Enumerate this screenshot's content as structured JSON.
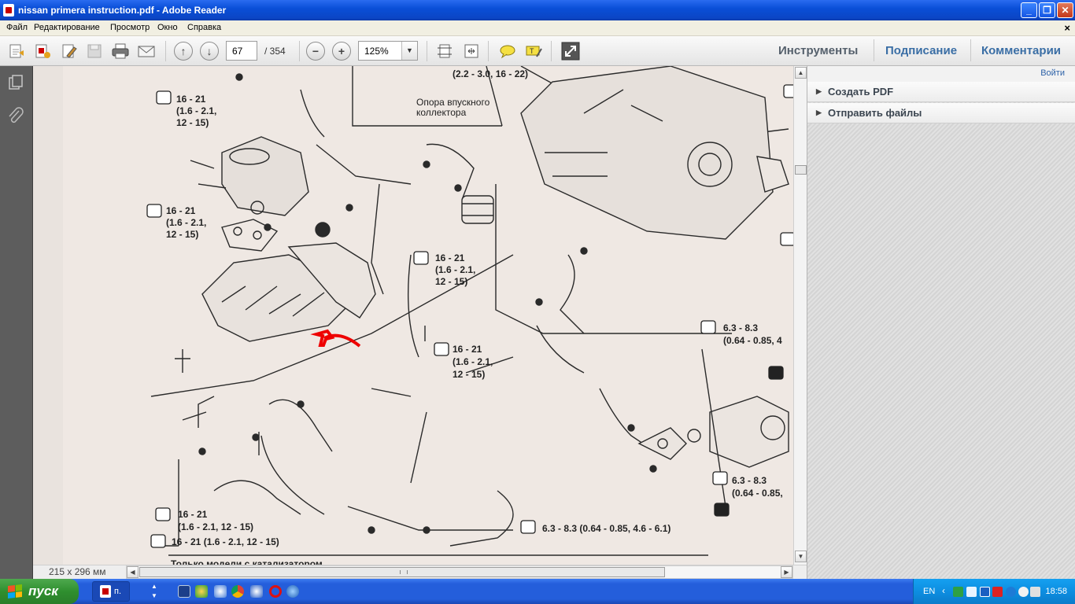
{
  "window": {
    "title": "nissan primera instruction.pdf - Adobe Reader"
  },
  "menu": {
    "items": [
      "Файл",
      "Редактирование",
      "Просмотр",
      "Окно",
      "Справка"
    ]
  },
  "toolbar": {
    "page_current": "67",
    "page_total": "/  354",
    "zoom": "125%"
  },
  "tabs": {
    "tools": "Инструменты",
    "sign": "Подписание",
    "comments": "Комментарии"
  },
  "right_panel": {
    "login": "Войти",
    "sections": [
      "Создать PDF",
      "Отправить файлы"
    ]
  },
  "status": {
    "page_size": "215 x 296 мм"
  },
  "document": {
    "labels": {
      "torque_a": "16 - 21",
      "torque_a2": "(1.6 - 2.1,",
      "torque_a3": "12 - 15)",
      "torque_top": "(2.2 - 3.0, 16 - 22)",
      "support_1": "Опора впускного",
      "support_2": "коллектора",
      "torque_b": "6.3 - 8.3",
      "torque_b2": "(0.64 - 0.85, 4",
      "torque_c": "6.3 - 8.3",
      "torque_c2": "(0.64 - 0.85,",
      "torque_d": "6.3 - 8.3 (0.64 - 0.85, 4.6 - 6.1)",
      "torque_e": "16 - 21",
      "torque_e2": "(1.6 - 2.1,  12 - 15)",
      "torque_f": "16 - 21  (1.6 - 2.1,  12 - 15)",
      "footer_text": "Только модели с катализатором"
    }
  },
  "taskbar": {
    "start": "пуск",
    "item": "п.",
    "lang": "EN",
    "clock": "18:58"
  }
}
